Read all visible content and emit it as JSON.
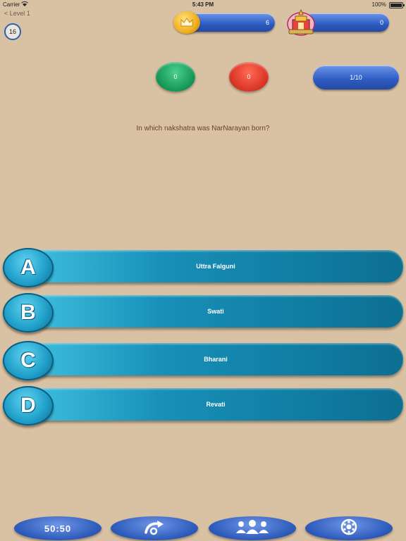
{
  "status_bar": {
    "carrier": "Carrier",
    "time": "5:43 PM",
    "battery": "100%"
  },
  "nav": {
    "back_label": "< Level 1"
  },
  "timer": {
    "seconds": "16"
  },
  "coins": {
    "value": "6"
  },
  "prize": {
    "value": "0"
  },
  "score": {
    "correct": "0",
    "wrong": "0",
    "progress": "1/10"
  },
  "question": {
    "text": "In which nakshatra was NarNarayan born?"
  },
  "answers": [
    {
      "letter": "A",
      "text": "Uttra Falguni"
    },
    {
      "letter": "B",
      "text": "Swati"
    },
    {
      "letter": "C",
      "text": "Bharani"
    },
    {
      "letter": "D",
      "text": "Revati"
    }
  ],
  "lifelines": {
    "fifty_fifty": "50:50",
    "icons": [
      "fifty-fifty",
      "skip-question-icon",
      "audience-poll-icon",
      "phone-dial-icon"
    ]
  },
  "colors": {
    "background": "#d9c1a3",
    "correct": "#139454",
    "wrong": "#d83223",
    "blue_pill": "#2d5bc2",
    "answer_bar": "#1890b8",
    "question_text": "#6b4220"
  }
}
